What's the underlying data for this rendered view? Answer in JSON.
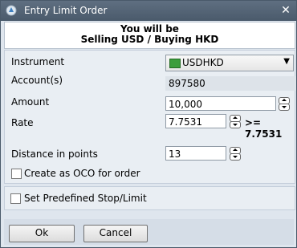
{
  "window": {
    "title": "Entry Limit Order",
    "close_icon": "close-icon"
  },
  "header": {
    "line1": "You will be",
    "line2": "Selling USD / Buying HKD"
  },
  "form": {
    "instrument_label": "Instrument",
    "instrument_value": "USDHKD",
    "account_label": "Account(s)",
    "account_value": "897580",
    "amount_label": "Amount",
    "amount_value": "10,000",
    "rate_label": "Rate",
    "rate_value": "7.7531",
    "rate_comparison": ">= 7.7531",
    "distance_label": "Distance in points",
    "distance_value": "13",
    "oco_label": "Create as OCO for order",
    "oco_checked": false
  },
  "stop_limit": {
    "label": "Set Predefined Stop/Limit",
    "checked": false
  },
  "buttons": {
    "ok": "Ok",
    "cancel": "Cancel"
  },
  "colors": {
    "titlebar": "#55657a",
    "flag": "#3c9e3c"
  }
}
